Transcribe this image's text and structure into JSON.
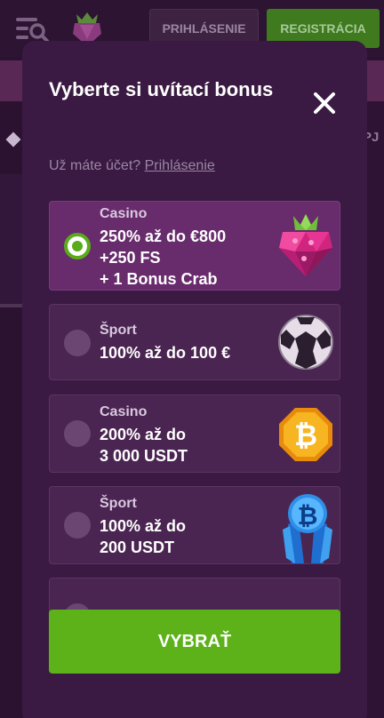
{
  "header": {
    "login_label": "PRIHLÁSENIE",
    "register_label": "REGISTRÁCIA",
    "right_text": "PJ"
  },
  "modal": {
    "title": "Vyberte si uvítací bonus",
    "account_question": "Už máte účet?",
    "login_link": "Prihlásenie",
    "select_button": "VYBRAŤ",
    "bonuses": [
      {
        "category": "Casino",
        "offer_lines": [
          "250% až do €800",
          "+250 FS",
          "+ 1 Bonus Crab"
        ],
        "selected": true,
        "icon": "raspberry-gem-icon"
      },
      {
        "category": "Šport",
        "offer_lines": [
          "100% až do 100 €"
        ],
        "selected": false,
        "icon": "soccer-ball-icon"
      },
      {
        "category": "Casino",
        "offer_lines": [
          "200% až do",
          "3 000 USDT"
        ],
        "selected": false,
        "icon": "bitcoin-coin-icon"
      },
      {
        "category": "Šport",
        "offer_lines": [
          "100% až do",
          "200 USDT"
        ],
        "selected": false,
        "icon": "bitcoin-crystal-icon"
      }
    ]
  },
  "colors": {
    "accent_green": "#5cb218",
    "modal_bg": "#3a1a42",
    "card_bg": "#4b2551",
    "selected_card_bg": "#682b6c"
  }
}
